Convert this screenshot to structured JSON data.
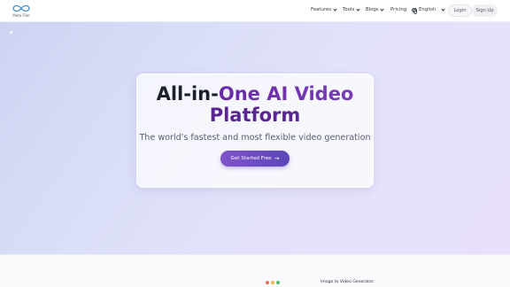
{
  "brand": {
    "name": "Meta Film"
  },
  "nav": {
    "features": "Features",
    "tools": "Tools",
    "blogs": "Blogs",
    "pricing": "Pricing",
    "language": "English",
    "login": "Login",
    "signup": "Sign Up"
  },
  "hero": {
    "title_part1": "All-in-",
    "title_part2": "One AI Video",
    "title_part3": "Platform",
    "subtitle": "The world's fastest and most flexible video generation",
    "cta_label": "Get Started Free"
  },
  "preview": {
    "label": "Image to Video Generator",
    "window_dots": [
      "#f26c4f",
      "#f5b748",
      "#49c468"
    ]
  },
  "colors": {
    "accent": "#6a3fc0",
    "title_purple": "#5a2592"
  }
}
